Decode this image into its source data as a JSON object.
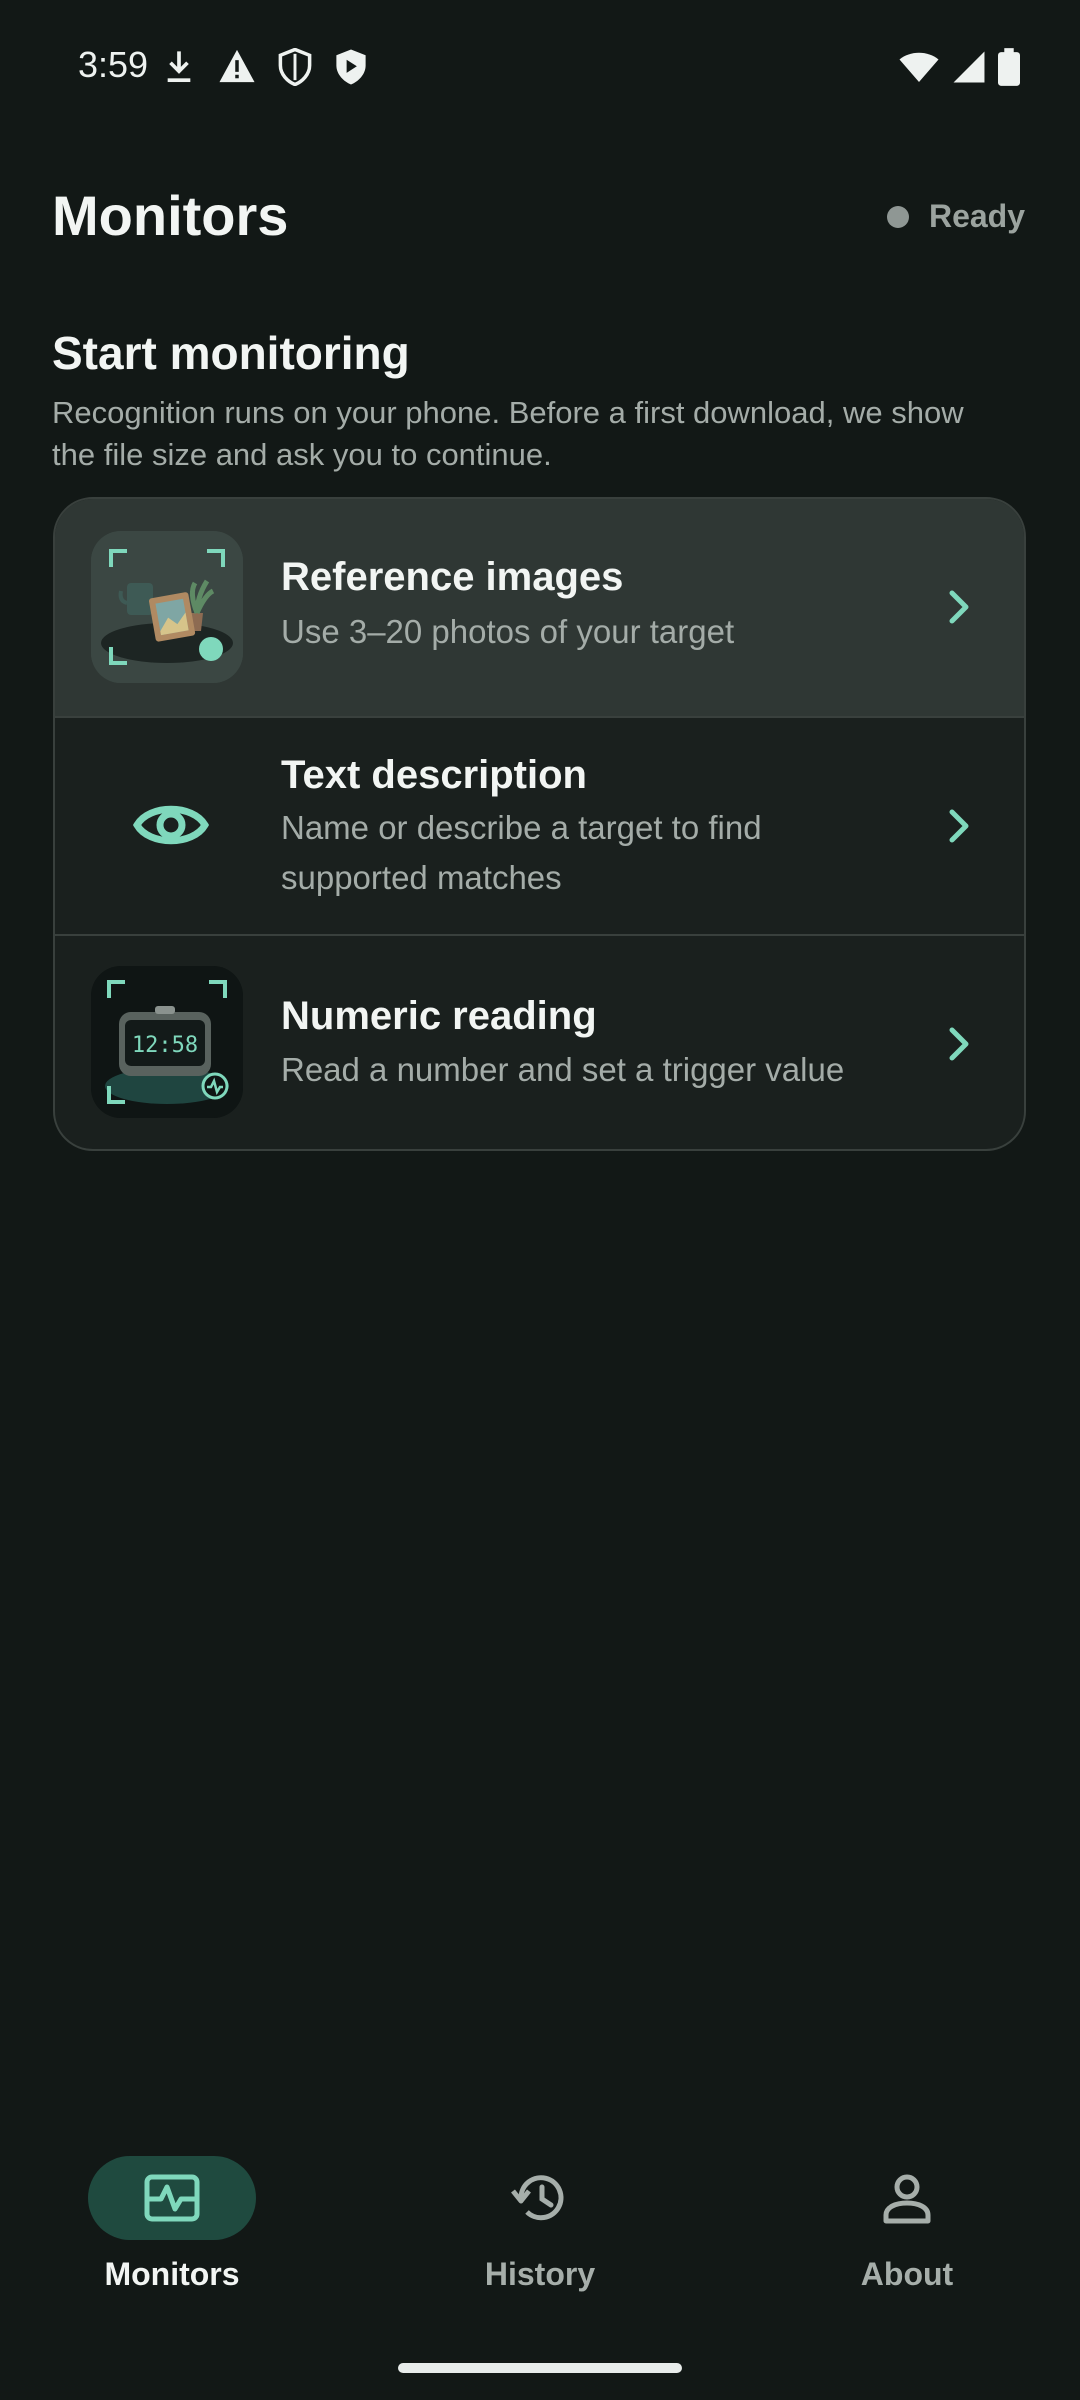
{
  "status_bar": {
    "time": "3:59",
    "left_icons": [
      "download-icon",
      "warning-icon",
      "shield-outline-icon",
      "shield-play-icon"
    ],
    "right_icons": [
      "wifi-icon",
      "signal-icon",
      "battery-icon"
    ]
  },
  "header": {
    "title": "Monitors",
    "status_label": "Ready"
  },
  "section": {
    "title": "Start monitoring",
    "description": "Recognition runs on your phone. Before a first download, we show the file size and ask you to continue."
  },
  "options": [
    {
      "title": "Reference images",
      "subtitle": "Use 3–20 photos of your target",
      "icon": "reference-images-thumbnail"
    },
    {
      "title": "Text description",
      "subtitle": "Name or describe a target to find supported matches",
      "icon": "eye-icon"
    },
    {
      "title": "Numeric reading",
      "subtitle": "Read a number and set a trigger value",
      "icon": "clock-display-thumbnail",
      "thumb_text": "12:58"
    }
  ],
  "bottom_nav": {
    "items": [
      {
        "label": "Monitors",
        "icon": "monitor-pulse-icon",
        "selected": true
      },
      {
        "label": "History",
        "icon": "history-icon",
        "selected": false
      },
      {
        "label": "About",
        "icon": "person-icon",
        "selected": false
      }
    ]
  },
  "colors": {
    "background": "#121816",
    "accent": "#7fd8bc",
    "selected_nav_pill": "#1f4a3f"
  }
}
